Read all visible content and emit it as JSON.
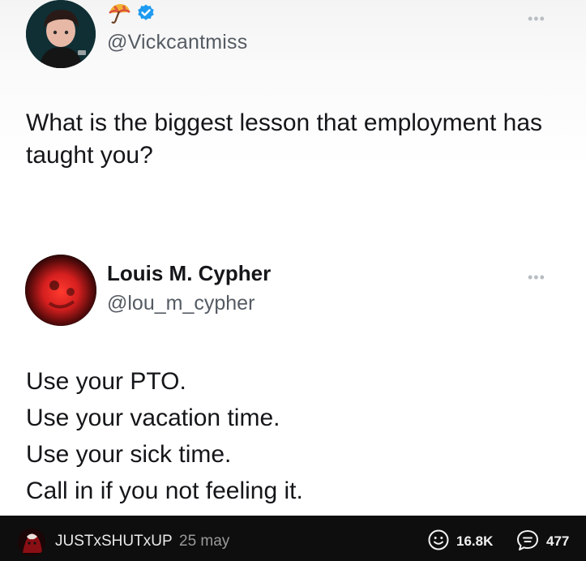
{
  "tweet": {
    "handle": "@Vickcantmiss",
    "text": "What is the biggest lesson that employment has taught you?",
    "badge_icons": [
      "umbrella-emoji-icon",
      "verified-badge-icon"
    ],
    "more_icon": "more-options-icon"
  },
  "reply": {
    "display_name": "Louis M. Cypher",
    "handle": "@lou_m_cypher",
    "lines": [
      "Use your PTO.",
      "Use your vacation time.",
      "Use your sick time.",
      "Call in if you not feeling it."
    ],
    "more_icon": "more-options-icon"
  },
  "footer": {
    "username": "JUSTxSHUTxUP",
    "date": "25 may",
    "reactions": "16.8K",
    "comments": "477"
  },
  "colors": {
    "bar_background": "#0e0e0e",
    "verified_blue": "#1d9bf0",
    "text": "#141619",
    "handle_gray": "#555b63"
  }
}
